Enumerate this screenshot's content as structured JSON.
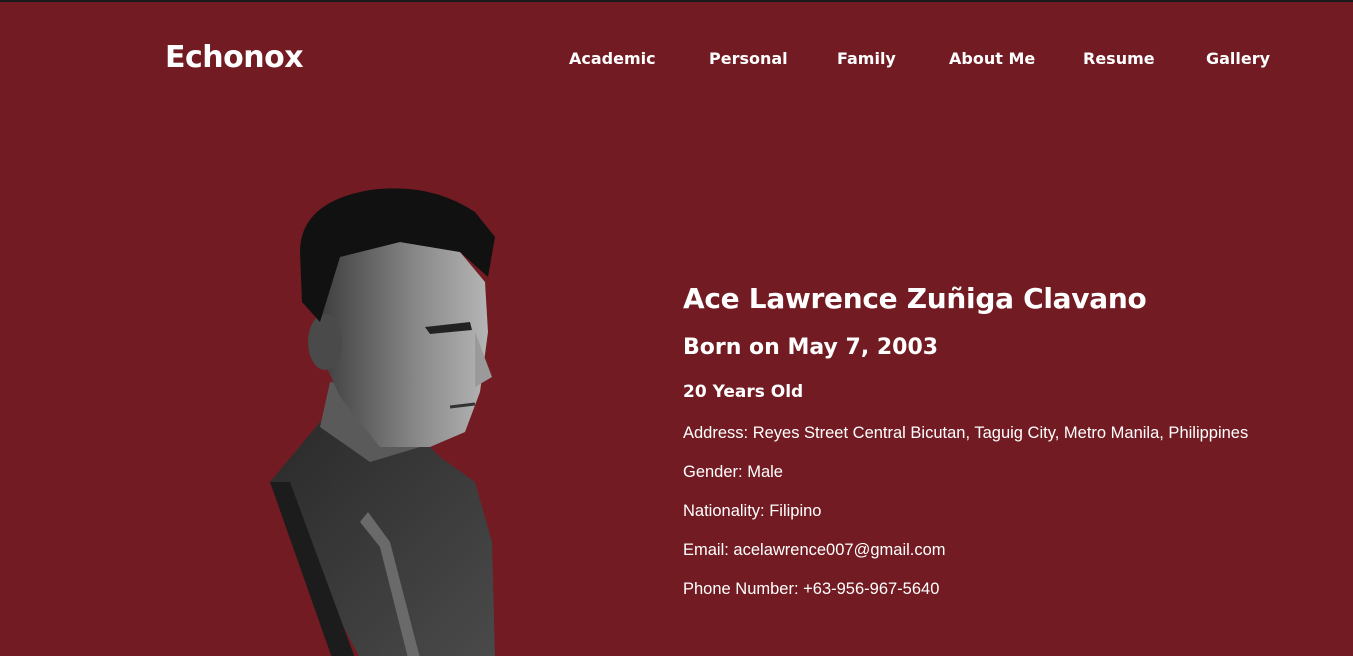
{
  "header": {
    "brand": "Echonox",
    "nav": [
      {
        "label": "Academic",
        "name": "nav-academic"
      },
      {
        "label": "Personal",
        "name": "nav-personal"
      },
      {
        "label": "Family",
        "name": "nav-family"
      },
      {
        "label": "About Me",
        "name": "nav-about-me"
      },
      {
        "label": "Resume",
        "name": "nav-resume"
      },
      {
        "label": "Gallery",
        "name": "nav-gallery"
      }
    ]
  },
  "profile": {
    "name": "Ace Lawrence Zuñiga Clavano",
    "born": "Born on May 7, 2003",
    "age": "20 Years Old",
    "details": [
      "Address: Reyes Street Central Bicutan, Taguig City, Metro Manila, Philippines",
      "Gender: Male",
      "Nationality: Filipino",
      "Email: acelawrence007@gmail.com",
      "Phone Number: +63-956-967-5640"
    ],
    "photo": "grayscale-portrait"
  },
  "colors": {
    "background": "#721b22",
    "text": "#ffffff"
  }
}
